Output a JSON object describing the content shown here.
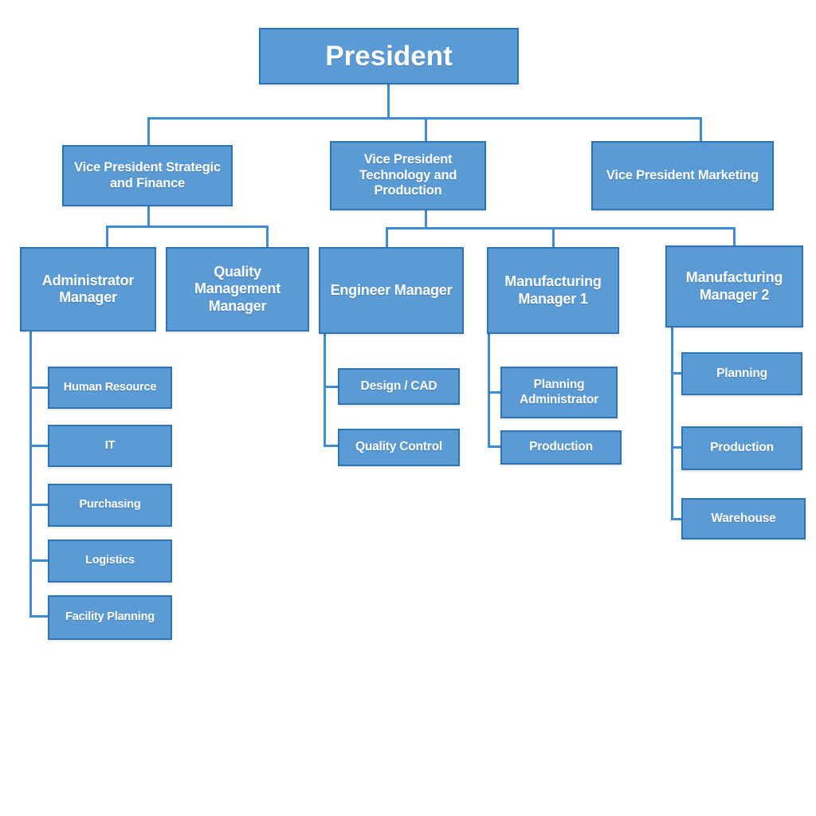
{
  "chart_type": "organization-chart",
  "theme": {
    "node_fill": "#5b9bd5",
    "node_border": "#2e74b5",
    "node_text": "#ffffff",
    "connector": "#3f8cd0",
    "background": "#ffffff"
  },
  "nodes": {
    "president": "President",
    "vp_strategic_finance": "Vice President Strategic and Finance",
    "vp_technology_production": "Vice President Technology and Production",
    "vp_marketing": "Vice President Marketing",
    "administrator_manager": "Administrator Manager",
    "quality_management_manager": "Quality Management Manager",
    "engineer_manager": "Engineer Manager",
    "manufacturing_manager_1": "Manufacturing Manager 1",
    "manufacturing_manager_2": "Manufacturing Manager 2",
    "human_resource": "Human Resource",
    "it": "IT",
    "purchasing": "Purchasing",
    "logistics": "Logistics",
    "facility_planning": "Facility Planning",
    "design_cad": "Design / CAD",
    "quality_control": "Quality Control",
    "planning_administrator": "Planning Administrator",
    "production_mfg1": "Production",
    "planning_mfg2": "Planning",
    "production_mfg2": "Production",
    "warehouse": "Warehouse"
  },
  "hierarchy": {
    "root": "President",
    "levels": [
      [
        "President"
      ],
      [
        "Vice President Strategic and Finance",
        "Vice President Technology and Production",
        "Vice President Marketing"
      ],
      [
        "Administrator Manager",
        "Quality Management Manager",
        "Engineer Manager",
        "Manufacturing Manager 1",
        "Manufacturing Manager 2"
      ],
      [
        "Human Resource",
        "IT",
        "Purchasing",
        "Logistics",
        "Facility Planning",
        "Design / CAD",
        "Quality Control",
        "Planning Administrator",
        "Production",
        "Planning",
        "Production",
        "Warehouse"
      ]
    ],
    "edges": [
      [
        "President",
        "Vice President Strategic and Finance"
      ],
      [
        "President",
        "Vice President Technology and Production"
      ],
      [
        "President",
        "Vice President Marketing"
      ],
      [
        "Vice President Strategic and Finance",
        "Administrator Manager"
      ],
      [
        "Vice President Strategic and Finance",
        "Quality Management Manager"
      ],
      [
        "Vice President Technology and Production",
        "Engineer Manager"
      ],
      [
        "Vice President Technology and Production",
        "Manufacturing Manager 1"
      ],
      [
        "Vice President Technology and Production",
        "Manufacturing Manager 2"
      ],
      [
        "Administrator Manager",
        "Human Resource"
      ],
      [
        "Administrator Manager",
        "IT"
      ],
      [
        "Administrator Manager",
        "Purchasing"
      ],
      [
        "Administrator Manager",
        "Logistics"
      ],
      [
        "Administrator Manager",
        "Facility Planning"
      ],
      [
        "Engineer Manager",
        "Design / CAD"
      ],
      [
        "Engineer Manager",
        "Quality Control"
      ],
      [
        "Manufacturing Manager 1",
        "Planning Administrator"
      ],
      [
        "Manufacturing Manager 1",
        "Production"
      ],
      [
        "Manufacturing Manager 2",
        "Planning"
      ],
      [
        "Manufacturing Manager 2",
        "Production"
      ],
      [
        "Manufacturing Manager 2",
        "Warehouse"
      ]
    ]
  }
}
